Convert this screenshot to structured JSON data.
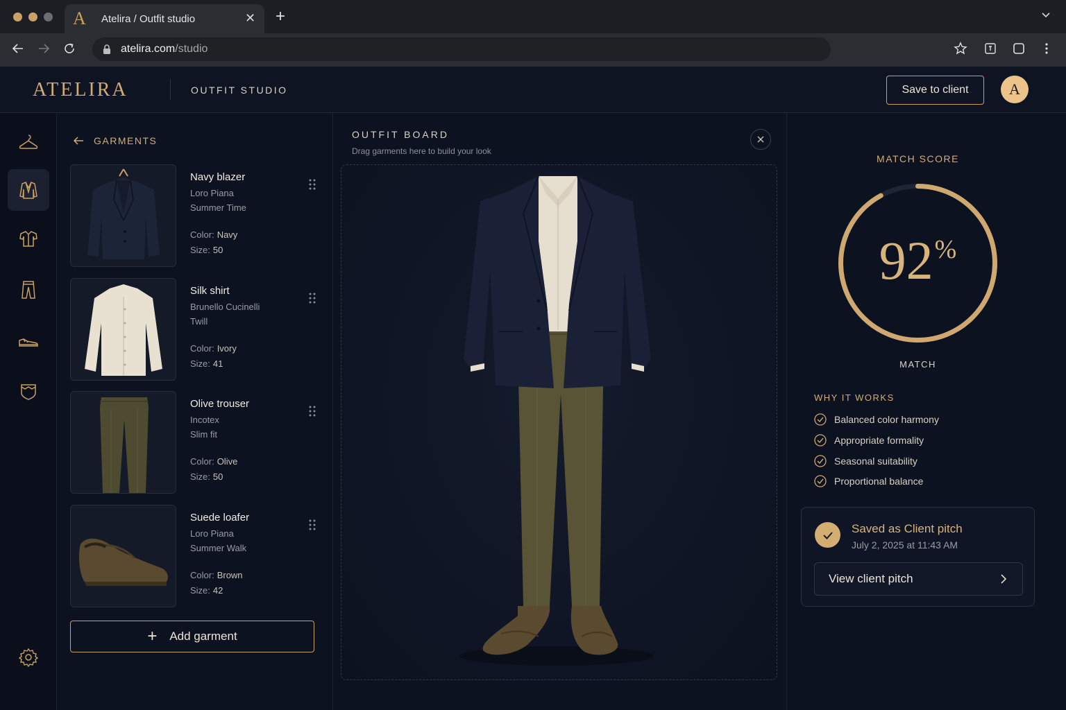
{
  "browser": {
    "tab_logo": "A",
    "tab_title": "Atelira  /  Outfit studio",
    "url_domain": "atelira.com",
    "url_path": "/studio"
  },
  "header": {
    "brand": "ATELIRA",
    "section": "OUTFIT STUDIO",
    "save_label": "Save to client",
    "avatar_initial": "A"
  },
  "garments": {
    "title": "GARMENTS",
    "color_label": "Color:",
    "size_label": "Size:",
    "items": [
      {
        "name": "Navy blazer",
        "brand": "Loro Piana",
        "line": "Summer Time",
        "color": "Navy",
        "size": "50"
      },
      {
        "name": "Silk shirt",
        "brand": "Brunello Cucinelli",
        "line": "Twill",
        "color": "Ivory",
        "size": "41"
      },
      {
        "name": "Olive trouser",
        "brand": "Incotex",
        "line": "Slim fit",
        "color": "Olive",
        "size": "50"
      },
      {
        "name": "Suede loafer",
        "brand": "Loro Piana",
        "line": "Summer Walk",
        "color": "Brown",
        "size": "42"
      }
    ],
    "add_label": "Add garment"
  },
  "board": {
    "title": "OUTFIT BOARD",
    "subtitle": "Drag garments here to build your look"
  },
  "match": {
    "title": "MATCH SCORE",
    "score": "92",
    "score_unit": "%",
    "score_fraction": 0.92,
    "label": "MATCH",
    "why_title": "WHY IT WORKS",
    "reasons": [
      "Balanced color harmony",
      "Appropriate formality",
      "Seasonal suitability",
      "Proportional balance"
    ]
  },
  "saved": {
    "title": "Saved as Client pitch",
    "date": "July 2, 2025 at 11:43 AM",
    "view_label": "View client pitch"
  },
  "colors": {
    "accent_gold": "#c9a164",
    "background": "#0d1220",
    "navy": "#1a2136",
    "olive": "#5a5436",
    "ivory": "#e6dfd0",
    "suede": "#5a4a30"
  },
  "icons": {
    "rail": [
      "hanger-icon",
      "jacket-icon",
      "shirt-icon",
      "trousers-icon",
      "shoe-icon",
      "pocket-square-icon",
      "settings-icon"
    ]
  }
}
